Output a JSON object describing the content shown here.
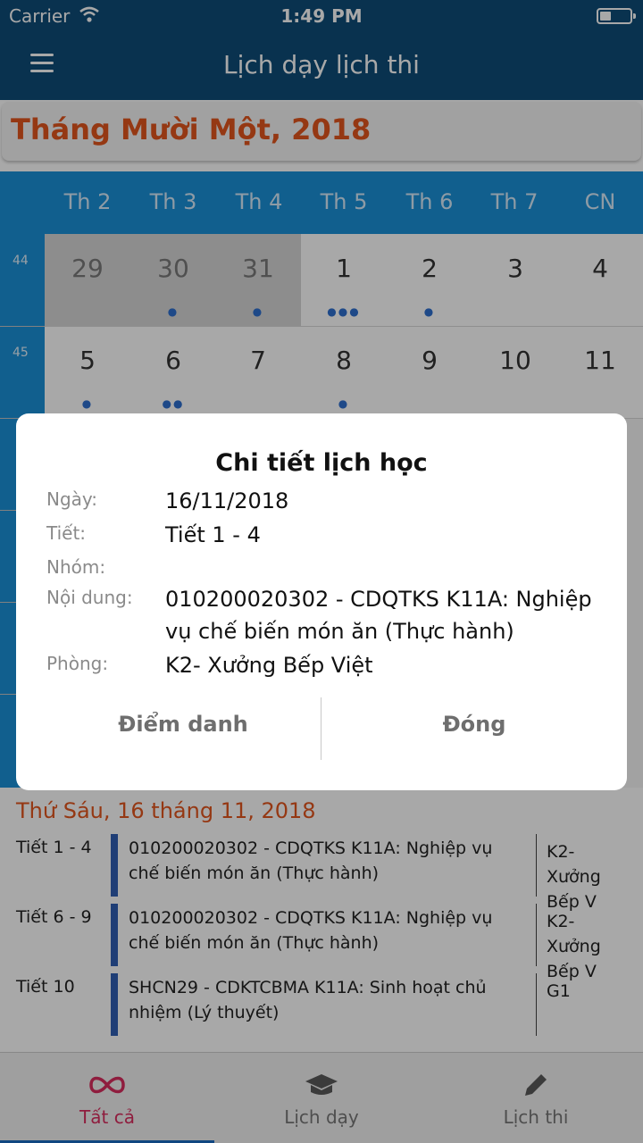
{
  "status_bar": {
    "carrier": "Carrier",
    "time": "1:49 PM"
  },
  "nav": {
    "title": "Lịch dạy lịch thi"
  },
  "calendar": {
    "month_label": "Tháng Mười Một, 2018",
    "weekdays": [
      "Th 2",
      "Th 3",
      "Th 4",
      "Th 5",
      "Th 6",
      "Th 7",
      "CN"
    ],
    "weeks": [
      {
        "week_number": "44",
        "days": [
          {
            "day": "29",
            "dots": 0,
            "prev_month": true
          },
          {
            "day": "30",
            "dots": 1,
            "prev_month": true
          },
          {
            "day": "31",
            "dots": 1,
            "prev_month": true
          },
          {
            "day": "1",
            "dots": 3,
            "prev_month": false
          },
          {
            "day": "2",
            "dots": 1,
            "prev_month": false
          },
          {
            "day": "3",
            "dots": 0,
            "prev_month": false
          },
          {
            "day": "4",
            "dots": 0,
            "prev_month": false
          }
        ]
      },
      {
        "week_number": "45",
        "days": [
          {
            "day": "5",
            "dots": 1,
            "prev_month": false
          },
          {
            "day": "6",
            "dots": 2,
            "prev_month": false
          },
          {
            "day": "7",
            "dots": 0,
            "prev_month": false
          },
          {
            "day": "8",
            "dots": 1,
            "prev_month": false
          },
          {
            "day": "9",
            "dots": 0,
            "prev_month": false
          },
          {
            "day": "10",
            "dots": 0,
            "prev_month": false
          },
          {
            "day": "11",
            "dots": 0,
            "prev_month": false
          }
        ]
      }
    ]
  },
  "events": {
    "day_heading": "Thứ Sáu, 16 tháng 11, 2018",
    "items": [
      {
        "tiet": "Tiết 1 - 4",
        "description": "010200020302 - CDQTKS K11A: Nghiệp vụ chế biến món ăn (Thực hành)",
        "room": "K2- Xưởng Bếp V"
      },
      {
        "tiet": "Tiết 6 - 9",
        "description": "010200020302 - CDQTKS K11A: Nghiệp vụ chế biến món ăn (Thực hành)",
        "room": "K2- Xưởng Bếp V"
      },
      {
        "tiet": "Tiết 10",
        "description": "SHCN29 - CDKTCBMA K11A: Sinh hoạt chủ nhiệm (Lý thuyết)",
        "room": "G1"
      }
    ]
  },
  "tabs": [
    {
      "label": "Tất cả",
      "icon": "infinity-icon",
      "active": true
    },
    {
      "label": "Lịch dạy",
      "icon": "graduation-cap-icon",
      "active": false
    },
    {
      "label": "Lịch thi",
      "icon": "pencil-icon",
      "active": false
    }
  ],
  "dialog": {
    "title": "Chi tiết lịch học",
    "fields": {
      "date_label": "Ngày:",
      "date_value": "16/11/2018",
      "period_label": "Tiết:",
      "period_value": "Tiết 1 - 4",
      "group_label": "Nhóm:",
      "group_value": "",
      "content_label": "Nội dung:",
      "content_value": "010200020302 - CDQTKS K11A: Nghiệp vụ chế biến món ăn (Thực hành)",
      "room_label": "Phòng:",
      "room_value": "K2- Xưởng Bếp Việt"
    },
    "attendance_button": "Điểm danh",
    "close_button": "Đóng"
  },
  "colors": {
    "nav_bg": "#0e4d79",
    "calendar_blue": "#1a90d8",
    "accent_orange": "#e3561e",
    "event_bar": "#2f5fb4",
    "active_tab": "#d92d5e"
  }
}
